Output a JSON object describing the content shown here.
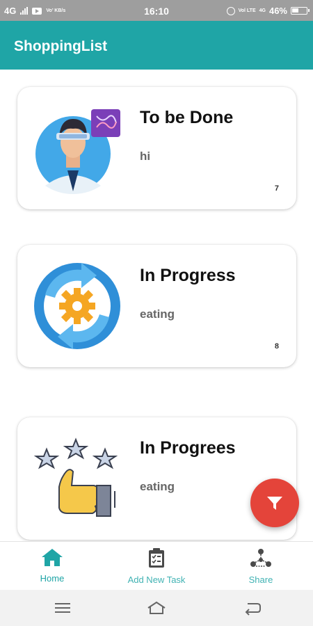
{
  "status_bar": {
    "network": "4G",
    "youtube_icon": "youtube-icon",
    "data_indicator": "Vo’ KB/s",
    "time": "16:10",
    "volte": "Vol LTE",
    "network_right": "4G",
    "battery": "46%"
  },
  "app_bar": {
    "title": "ShoppingList"
  },
  "cards": [
    {
      "title": "To be Done",
      "subtitle": "hi",
      "count": "7",
      "icon": "scientist-vr-avatar"
    },
    {
      "title": "In Progress",
      "subtitle": "eating",
      "count": "8",
      "icon": "gear-cycle-icon"
    },
    {
      "title": "In Progrees",
      "subtitle": "eating",
      "count": "",
      "icon": "thumbs-up-stars-icon"
    }
  ],
  "fab": {
    "icon": "filter-icon"
  },
  "bottom_nav": {
    "items": [
      {
        "label": "Home",
        "icon": "home-icon"
      },
      {
        "label": "Add New Task",
        "icon": "clipboard-icon"
      },
      {
        "label": "Share",
        "icon": "share-network-icon"
      }
    ]
  },
  "colors": {
    "primary": "#1fa5a6",
    "fab": "#e4443a",
    "status_bar": "#9e9e9e"
  }
}
